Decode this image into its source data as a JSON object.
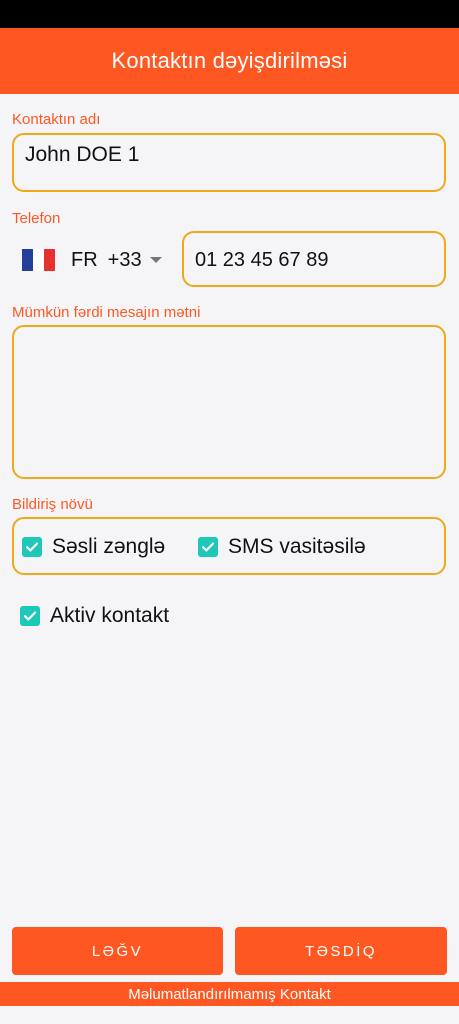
{
  "header": {
    "title": "Kontaktın dəyişdirilməsi"
  },
  "contact_name": {
    "label": "Kontaktın adı",
    "value": "John DOE 1"
  },
  "phone": {
    "label": "Telefon",
    "country_code": "FR",
    "dial_code": "+33",
    "number": "01 23 45 67 89",
    "flag_colors": [
      "#22409a",
      "#ffffff",
      "#e6312f"
    ]
  },
  "message": {
    "label": "Mümkün fərdi mesajın mətni",
    "value": ""
  },
  "notification": {
    "label": "Bildiriş növü",
    "options": [
      {
        "label": "Səsli zənglə",
        "checked": true
      },
      {
        "label": "SMS vasitəsilə",
        "checked": true
      }
    ]
  },
  "active_contact": {
    "label": "Aktiv kontakt",
    "checked": true
  },
  "actions": {
    "cancel_label": "LƏĞV",
    "confirm_label": "TƏSDİQ"
  },
  "footer": {
    "text": "Məlumatlandırılmamış Kontakt"
  },
  "colors": {
    "accent": "#ff5722",
    "field_border": "#f0a81a",
    "checkbox": "#1ec8b8",
    "background": "#f5f5f8"
  }
}
